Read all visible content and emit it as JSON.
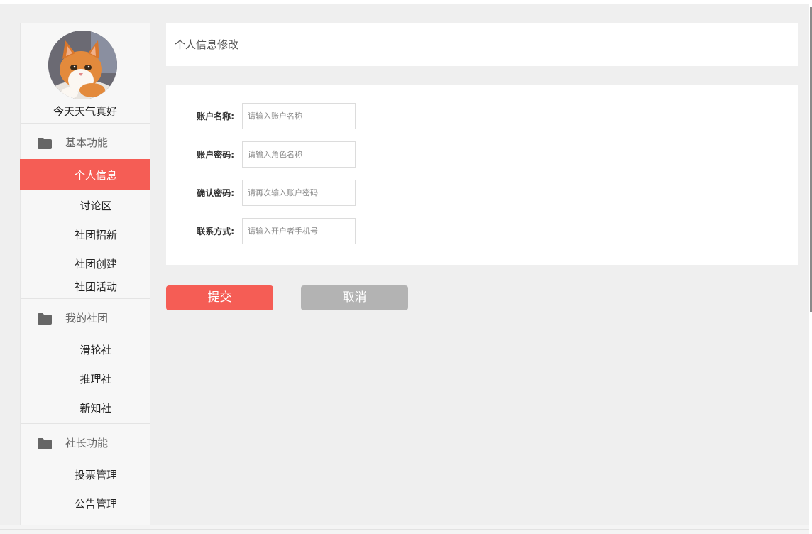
{
  "sidebar": {
    "nickname": "今天天气真好",
    "groups": [
      {
        "title": "基本功能",
        "icon": "folder-icon",
        "items": [
          "个人信息",
          "讨论区",
          "社团招新",
          "社团创建",
          "社团活动"
        ]
      },
      {
        "title": "我的社团",
        "icon": "folder-icon",
        "items": [
          "滑轮社",
          "推理社",
          "新知社"
        ]
      },
      {
        "title": "社长功能",
        "icon": "folder-icon",
        "items": [
          "投票管理",
          "公告管理"
        ]
      }
    ],
    "active_item": "个人信息"
  },
  "header": {
    "title": "个人信息修改"
  },
  "form": {
    "fields": [
      {
        "label": "账户名称:",
        "placeholder": "请输入账户名称",
        "value": ""
      },
      {
        "label": "账户密码:",
        "placeholder": "请输入角色名称",
        "value": ""
      },
      {
        "label": "确认密码:",
        "placeholder": "请再次输入账户密码",
        "value": ""
      },
      {
        "label": "联系方式:",
        "placeholder": "请输入开户者手机号",
        "value": ""
      }
    ]
  },
  "buttons": {
    "submit_label": "提交",
    "cancel_label": "取消"
  },
  "colors": {
    "accent": "#f55d55",
    "cancel": "#b3b3b3",
    "background": "#efefef",
    "sidebar_bg": "#f7f7f7"
  }
}
